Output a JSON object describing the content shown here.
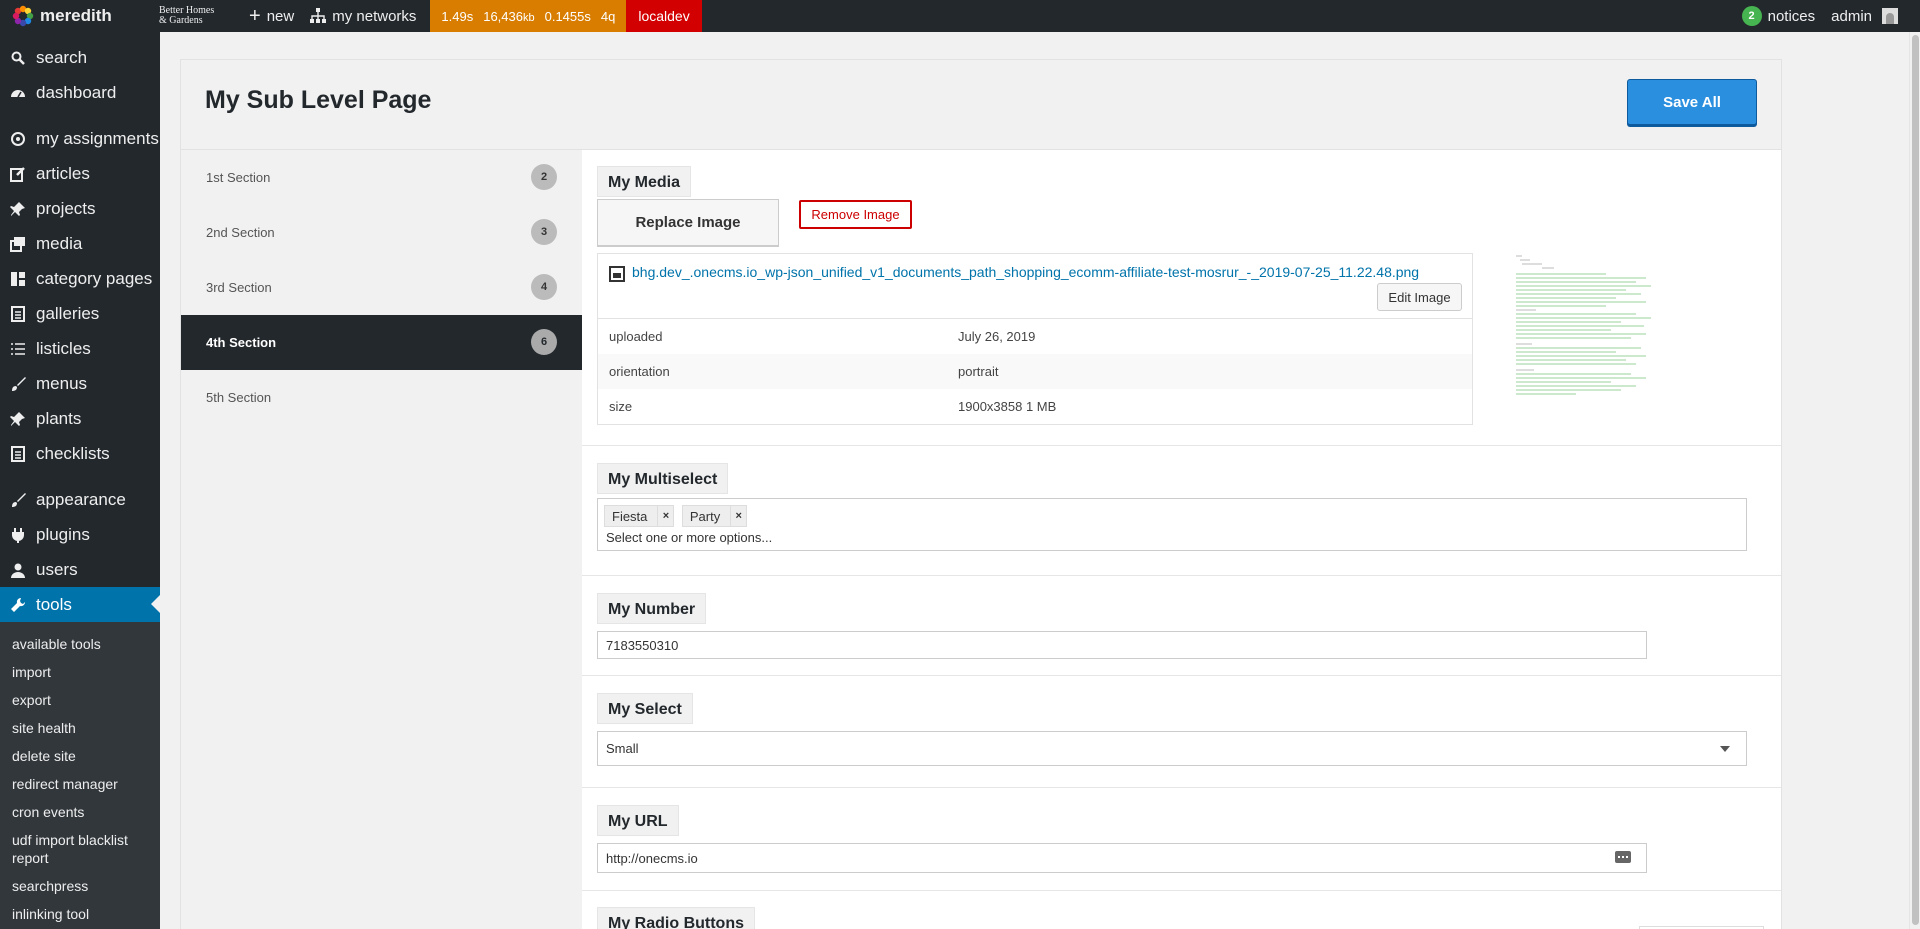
{
  "adminbar": {
    "brand": "meredith",
    "bhg_line1": "Better Homes",
    "bhg_line2": "& Gardens",
    "new_label": "new",
    "networks_label": "my networks",
    "perf": {
      "time": "1.49s",
      "memory": "16,436",
      "memory_unit": "kb",
      "query_time": "0.1455s",
      "queries": "4q"
    },
    "env": "localdev",
    "notices_count": "2",
    "notices_label": "notices",
    "user": "admin"
  },
  "menu": {
    "items": [
      {
        "label": "search",
        "icon": "search-icon"
      },
      {
        "label": "dashboard",
        "icon": "dashboard-icon"
      },
      {
        "label": "my assignments",
        "icon": "assignments-icon"
      },
      {
        "label": "articles",
        "icon": "edit-icon"
      },
      {
        "label": "projects",
        "icon": "pin-icon"
      },
      {
        "label": "media",
        "icon": "media-icon"
      },
      {
        "label": "category pages",
        "icon": "grid-icon"
      },
      {
        "label": "galleries",
        "icon": "document-icon"
      },
      {
        "label": "listicles",
        "icon": "list-icon"
      },
      {
        "label": "menus",
        "icon": "brush-icon"
      },
      {
        "label": "plants",
        "icon": "pin-icon"
      },
      {
        "label": "checklists",
        "icon": "document-icon"
      },
      {
        "label": "appearance",
        "icon": "brush-icon"
      },
      {
        "label": "plugins",
        "icon": "plugin-icon"
      },
      {
        "label": "users",
        "icon": "user-icon"
      },
      {
        "label": "tools",
        "icon": "wrench-icon"
      }
    ],
    "submenu": [
      "available tools",
      "import",
      "export",
      "site health",
      "delete site",
      "redirect manager",
      "cron events",
      "udf import blacklist report",
      "searchpress",
      "inlinking tool"
    ]
  },
  "page": {
    "title": "My Sub Level Page",
    "save_label": "Save All"
  },
  "sections": [
    {
      "label": "1st Section",
      "count": "2"
    },
    {
      "label": "2nd Section",
      "count": "3"
    },
    {
      "label": "3rd Section",
      "count": "4"
    },
    {
      "label": "4th Section",
      "count": "6"
    },
    {
      "label": "5th Section",
      "count": ""
    }
  ],
  "media": {
    "label": "My Media",
    "replace_label": "Replace Image",
    "remove_label": "Remove Image",
    "filename": "bhg.dev_.onecms.io_wp-json_unified_v1_documents_path_shopping_ecomm-affiliate-test-mosrur_-_2019-07-25_11.22.48.png",
    "edit_label": "Edit Image",
    "meta": [
      {
        "key": "uploaded",
        "value": "July 26, 2019"
      },
      {
        "key": "orientation",
        "value": "portrait"
      },
      {
        "key": "size",
        "value": "1900x3858 1 MB"
      }
    ]
  },
  "multiselect": {
    "label": "My Multiselect",
    "tags": [
      "Fiesta",
      "Party"
    ],
    "remove_glyph": "×",
    "placeholder": "Select one or more options..."
  },
  "number": {
    "label": "My Number",
    "value": "7183550310"
  },
  "select": {
    "label": "My Select",
    "value": "Small"
  },
  "url": {
    "label": "My URL",
    "value": "http://onecms.io"
  },
  "radio": {
    "label": "My Radio Buttons"
  },
  "colors": {
    "adminbar_bg": "#23282d",
    "accent": "#0073aa",
    "perf_bg": "#d87d00",
    "env_bg": "#d20000",
    "save_bg": "#2b8fe0",
    "remove_red": "#cc0000",
    "notice_green": "#46b450"
  }
}
